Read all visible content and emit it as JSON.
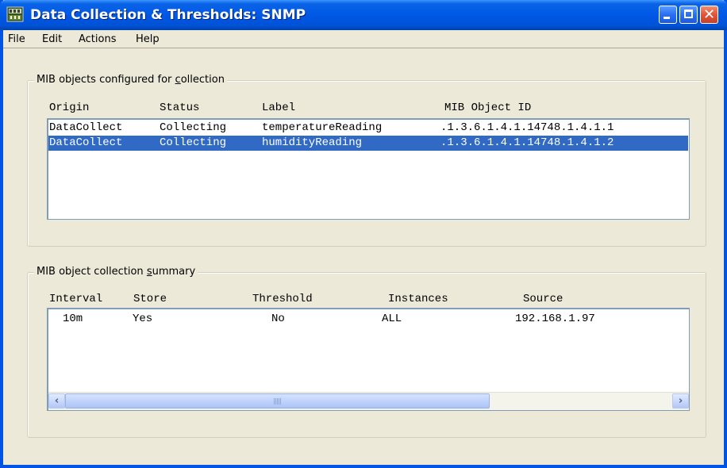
{
  "window": {
    "title": "Data Collection & Thresholds: SNMP"
  },
  "menu": {
    "file": "File",
    "edit": "Edit",
    "actions": "Actions",
    "help": "Help"
  },
  "mib_objects": {
    "group_label_pre": "MIB objects configured for ",
    "group_label_key": "c",
    "group_label_post": "ollection",
    "columns": [
      "Origin",
      "Status",
      "Label",
      "MIB Object ID"
    ],
    "rows": [
      {
        "origin": "DataCollect",
        "status": "Collecting",
        "label": "temperatureReading",
        "oid": ".1.3.6.1.4.1.14748.1.4.1.1",
        "selected": false
      },
      {
        "origin": "DataCollect",
        "status": "Collecting",
        "label": "humidityReading",
        "oid": ".1.3.6.1.4.1.14748.1.4.1.2",
        "selected": true
      }
    ]
  },
  "summary": {
    "group_label_pre": "MIB object collection ",
    "group_label_key": "s",
    "group_label_post": "ummary",
    "columns": [
      "Interval",
      "Store",
      "Threshold",
      "Instances",
      "Source"
    ],
    "rows": [
      {
        "interval": "10m",
        "store": "Yes",
        "threshold": "No",
        "instances": "ALL",
        "source": "192.168.1.97"
      }
    ],
    "scroll_position": 0.0
  },
  "colors": {
    "titlebar": "#0058e6",
    "selection": "#316ac5",
    "window_bg": "#ece9d8"
  }
}
